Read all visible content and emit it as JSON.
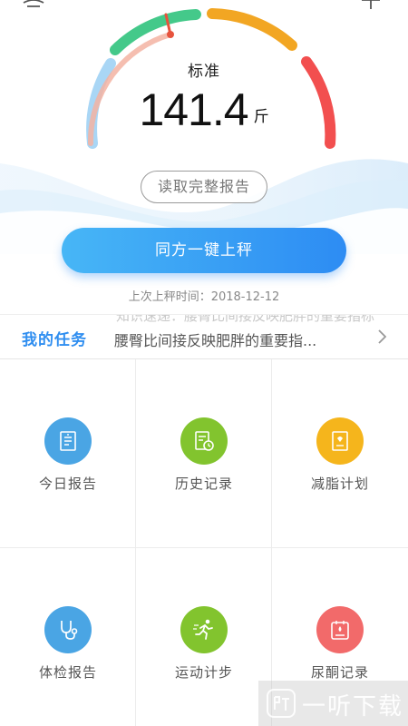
{
  "header": {
    "menu_icon": "menu-icon",
    "add_icon": "plus-icon"
  },
  "gauge": {
    "status": "标准",
    "weight": "141.4",
    "unit": "斤",
    "colors": {
      "low": "#a9d6f5",
      "standard": "#44c98a",
      "high": "#f2a623",
      "obese": "#f24f4f",
      "indicator": "#e7533d"
    }
  },
  "report_button": {
    "label": "读取完整报告"
  },
  "scale_button": {
    "label": "同方一键上秤"
  },
  "last_weigh": {
    "text": "上次上秤时间：2018-12-12"
  },
  "tasks": {
    "title": "我的任务",
    "ghost_text": "知识速递：腰臀比间接反映肥胖的重要指标",
    "text": "腰臀比间接反映肥胖的重要指...",
    "arrow_icon": "chevron-right-icon"
  },
  "grid": {
    "items": [
      {
        "label": "今日报告",
        "icon": "document-icon",
        "color": "#4aa5e4"
      },
      {
        "label": "历史记录",
        "icon": "history-icon",
        "color": "#82c42e"
      },
      {
        "label": "减脂计划",
        "icon": "plan-icon",
        "color": "#f5b51c"
      },
      {
        "label": "体检报告",
        "icon": "stethoscope-icon",
        "color": "#4aa5e4"
      },
      {
        "label": "运动计步",
        "icon": "running-icon",
        "color": "#82c42e"
      },
      {
        "label": "尿酮记录",
        "icon": "urine-icon",
        "color": "#f26a6a"
      }
    ]
  },
  "watermark": {
    "text": "一听下载"
  }
}
